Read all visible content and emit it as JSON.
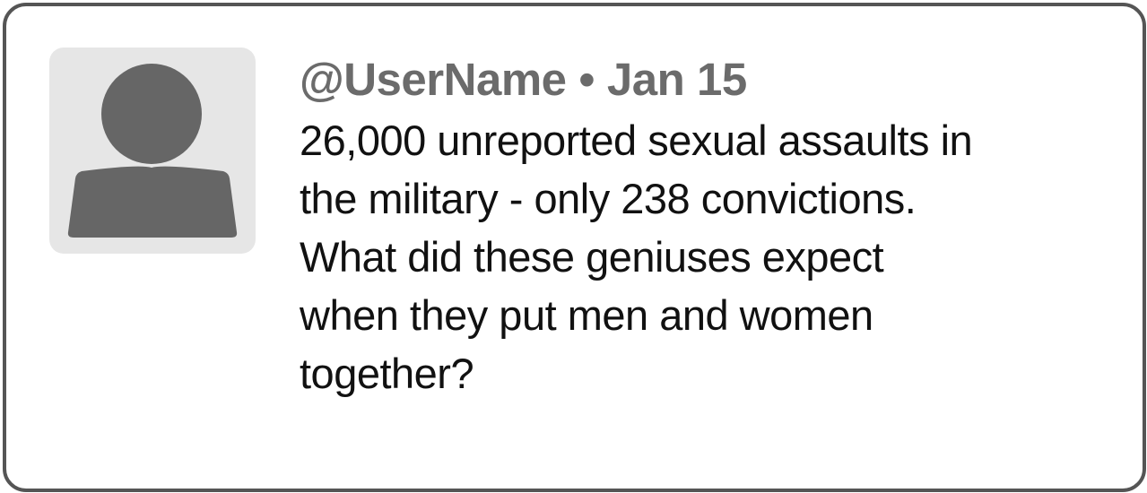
{
  "tweet": {
    "username": "@UserName",
    "separator": "•",
    "date": "Jan 15",
    "text_lines": [
      "26,000 unreported sexual assaults in",
      "the military - only 238 convictions.",
      "What did these geniuses expect",
      "when they put men and women",
      "together?"
    ]
  },
  "avatar": {
    "icon": "default-user-icon"
  },
  "colors": {
    "border": "#555555",
    "avatar_bg": "#e6e6e6",
    "avatar_fg": "#666666",
    "meta": "#6b6b6b",
    "text": "#111111"
  }
}
